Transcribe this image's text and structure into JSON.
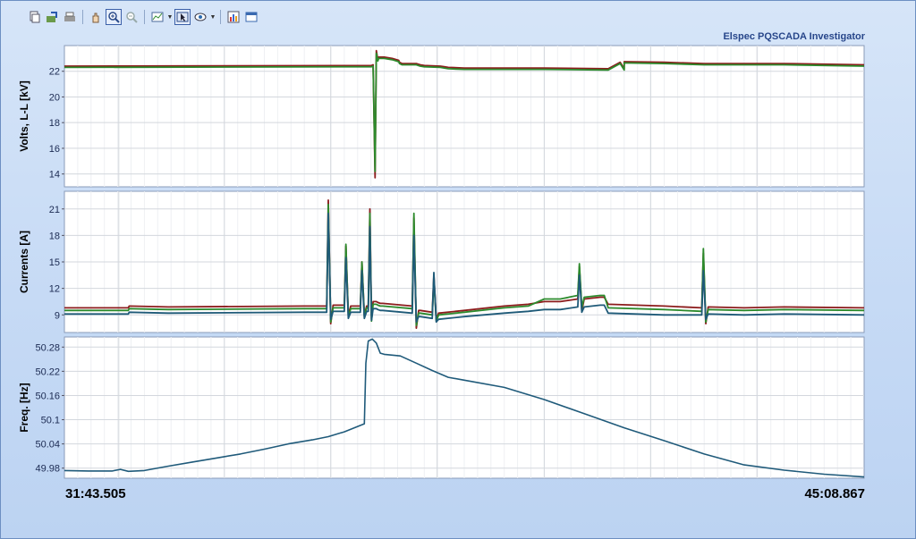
{
  "app": {
    "brand": "Elspec PQSCADA Investigator"
  },
  "toolbar": {
    "tools": [
      {
        "name": "copy-icon",
        "active": false
      },
      {
        "name": "export-icon",
        "active": false
      },
      {
        "name": "print-icon",
        "active": false
      },
      {
        "name": "pan-hand-icon",
        "active": false
      },
      {
        "name": "zoom-in-icon",
        "active": true
      },
      {
        "name": "zoom-out-icon",
        "active": false
      },
      {
        "name": "chart-type-icon",
        "active": false,
        "dropdown": true
      },
      {
        "name": "cursor-icon",
        "active": true
      },
      {
        "name": "markers-icon",
        "active": false,
        "dropdown": true
      },
      {
        "name": "chart-properties-icon",
        "active": false
      },
      {
        "name": "window-icon",
        "active": false
      }
    ]
  },
  "chart_data": {
    "type": "line",
    "x_start": "31:43.505",
    "x_end": "45:08.867",
    "grid": true,
    "colors": {
      "phase1": "#8c1c1c",
      "phase2": "#2c8a2c",
      "phase3": "#1e5a78",
      "freq": "#1f5a7a"
    },
    "panels": [
      {
        "ylabel": "Volts, L-L [kV]",
        "ylim": [
          13,
          24
        ],
        "yticks": [
          14,
          16,
          18,
          20,
          22
        ],
        "series": [
          {
            "color_key": "phase1",
            "x": [
              0,
              0.384,
              0.386,
              0.3885,
              0.39,
              0.392,
              0.393,
              0.4,
              0.41,
              0.418,
              0.419,
              0.422,
              0.44,
              0.445,
              0.45,
              0.47,
              0.475,
              0.48,
              0.5,
              0.6,
              0.7,
              0.68,
              0.695,
              0.7,
              0.75,
              0.8,
              0.9,
              1.0
            ],
            "y": [
              22.4,
              22.45,
              22.5,
              13.7,
              23.6,
              22.9,
              23.1,
              23.1,
              23.0,
              22.85,
              22.7,
              22.6,
              22.6,
              22.5,
              22.45,
              22.4,
              22.35,
              22.3,
              22.25,
              22.25,
              22.2,
              22.2,
              22.7,
              22.75,
              22.7,
              22.6,
              22.6,
              22.5
            ]
          },
          {
            "color_key": "phase2",
            "x": [
              0,
              0.384,
              0.386,
              0.3885,
              0.39,
              0.392,
              0.393,
              0.4,
              0.41,
              0.418,
              0.419,
              0.422,
              0.44,
              0.445,
              0.45,
              0.47,
              0.475,
              0.48,
              0.5,
              0.6,
              0.7,
              0.68,
              0.695,
              0.7,
              0.75,
              0.8,
              0.9,
              1.0
            ],
            "y": [
              22.3,
              22.35,
              22.4,
              14.2,
              23.4,
              22.8,
              23.0,
              23.0,
              22.9,
              22.75,
              22.6,
              22.5,
              22.5,
              22.4,
              22.35,
              22.3,
              22.25,
              22.2,
              22.15,
              22.15,
              22.1,
              22.1,
              22.6,
              22.65,
              22.6,
              22.5,
              22.5,
              22.4
            ]
          }
        ]
      },
      {
        "ylabel": "Currents [A]",
        "ylim": [
          7,
          23
        ],
        "yticks": [
          9,
          12,
          15,
          18,
          21
        ],
        "series": [
          {
            "color_key": "phase1",
            "x": [
              0,
              0.08,
              0.081,
              0.13,
              0.3,
              0.328,
              0.33,
              0.333,
              0.336,
              0.35,
              0.352,
              0.355,
              0.358,
              0.37,
              0.372,
              0.375,
              0.378,
              0.38,
              0.382,
              0.384,
              0.386,
              0.39,
              0.392,
              0.395,
              0.398,
              0.435,
              0.437,
              0.44,
              0.443,
              0.445,
              0.46,
              0.462,
              0.465,
              0.468,
              0.5,
              0.55,
              0.58,
              0.6,
              0.62,
              0.642,
              0.644,
              0.647,
              0.65,
              0.67,
              0.675,
              0.68,
              0.75,
              0.797,
              0.799,
              0.802,
              0.805,
              0.85,
              0.9,
              1.0
            ],
            "y": [
              9.8,
              9.8,
              10.0,
              9.9,
              10.0,
              10.0,
              22.0,
              8.0,
              10.1,
              10.1,
              16.8,
              9.0,
              10.0,
              10.0,
              15.0,
              9.0,
              10.0,
              10.0,
              21.0,
              8.5,
              10.5,
              10.5,
              10.4,
              10.3,
              10.3,
              10.0,
              20.0,
              7.5,
              9.5,
              9.5,
              9.3,
              13.5,
              8.5,
              9.2,
              9.5,
              10.0,
              10.2,
              10.5,
              10.5,
              10.8,
              14.5,
              9.5,
              10.8,
              11.0,
              11.0,
              10.2,
              10.0,
              9.8,
              16.0,
              8.0,
              9.9,
              9.8,
              9.9,
              9.8
            ]
          },
          {
            "color_key": "phase2",
            "x": [
              0,
              0.08,
              0.081,
              0.13,
              0.3,
              0.328,
              0.33,
              0.333,
              0.336,
              0.35,
              0.352,
              0.355,
              0.358,
              0.37,
              0.372,
              0.375,
              0.378,
              0.38,
              0.382,
              0.384,
              0.386,
              0.39,
              0.392,
              0.395,
              0.398,
              0.435,
              0.437,
              0.44,
              0.443,
              0.445,
              0.46,
              0.462,
              0.465,
              0.468,
              0.5,
              0.55,
              0.58,
              0.6,
              0.62,
              0.642,
              0.644,
              0.647,
              0.65,
              0.67,
              0.675,
              0.68,
              0.75,
              0.797,
              0.799,
              0.802,
              0.805,
              0.85,
              0.9,
              1.0
            ],
            "y": [
              9.5,
              9.5,
              9.7,
              9.6,
              9.7,
              9.7,
              21.5,
              8.2,
              9.8,
              9.8,
              17.0,
              8.8,
              9.7,
              9.7,
              15.0,
              8.8,
              9.8,
              9.8,
              20.5,
              8.3,
              10.2,
              10.2,
              10.1,
              10.0,
              10.0,
              9.7,
              20.5,
              7.8,
              9.2,
              9.2,
              9.0,
              13.0,
              8.3,
              9.0,
              9.3,
              9.8,
              10.0,
              10.8,
              10.8,
              11.2,
              14.8,
              9.8,
              11.0,
              11.2,
              11.2,
              9.8,
              9.6,
              9.4,
              16.5,
              8.2,
              9.6,
              9.5,
              9.6,
              9.5
            ]
          },
          {
            "color_key": "phase3",
            "x": [
              0,
              0.08,
              0.081,
              0.13,
              0.3,
              0.328,
              0.33,
              0.333,
              0.336,
              0.35,
              0.352,
              0.355,
              0.358,
              0.37,
              0.372,
              0.375,
              0.378,
              0.38,
              0.382,
              0.384,
              0.386,
              0.39,
              0.392,
              0.395,
              0.398,
              0.435,
              0.437,
              0.44,
              0.443,
              0.445,
              0.46,
              0.462,
              0.465,
              0.468,
              0.5,
              0.55,
              0.58,
              0.6,
              0.62,
              0.642,
              0.644,
              0.647,
              0.65,
              0.67,
              0.675,
              0.68,
              0.75,
              0.797,
              0.799,
              0.802,
              0.805,
              0.85,
              0.9,
              1.0
            ],
            "y": [
              9.1,
              9.1,
              9.3,
              9.2,
              9.3,
              9.3,
              20.5,
              8.5,
              9.4,
              9.4,
              15.5,
              8.6,
              9.3,
              9.3,
              14.0,
              8.6,
              9.4,
              9.4,
              19.0,
              8.4,
              9.7,
              9.7,
              9.6,
              9.5,
              9.5,
              9.2,
              18.0,
              8.2,
              8.8,
              8.8,
              8.6,
              13.8,
              8.2,
              8.5,
              8.8,
              9.2,
              9.4,
              9.6,
              9.6,
              9.9,
              13.5,
              9.3,
              9.9,
              10.1,
              10.1,
              9.2,
              9.0,
              9.0,
              14.0,
              8.5,
              9.1,
              9.0,
              9.1,
              9.0
            ]
          }
        ]
      },
      {
        "ylabel": "Freq. [Hz]",
        "ylim": [
          49.955,
          50.305
        ],
        "yticks": [
          49.98,
          50.04,
          50.1,
          50.16,
          50.22,
          50.28
        ],
        "series": [
          {
            "color_key": "freq",
            "x": [
              0,
              0.03,
              0.06,
              0.07,
              0.08,
              0.1,
              0.13,
              0.16,
              0.19,
              0.22,
              0.25,
              0.28,
              0.31,
              0.33,
              0.35,
              0.375,
              0.377,
              0.38,
              0.385,
              0.39,
              0.395,
              0.4,
              0.42,
              0.44,
              0.46,
              0.48,
              0.5,
              0.55,
              0.6,
              0.65,
              0.7,
              0.75,
              0.8,
              0.85,
              0.9,
              0.95,
              1.0
            ],
            "y": [
              49.974,
              49.973,
              49.973,
              49.977,
              49.972,
              49.974,
              49.985,
              49.995,
              50.005,
              50.015,
              50.027,
              50.04,
              50.05,
              50.058,
              50.07,
              50.09,
              50.24,
              50.295,
              50.3,
              50.29,
              50.265,
              50.262,
              50.258,
              50.24,
              50.222,
              50.205,
              50.198,
              50.18,
              50.15,
              50.115,
              50.08,
              50.048,
              50.015,
              49.988,
              49.975,
              49.965,
              49.958
            ]
          }
        ]
      }
    ]
  }
}
